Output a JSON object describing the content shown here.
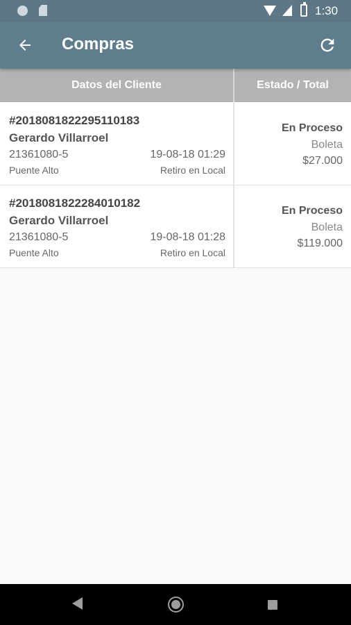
{
  "status_bar": {
    "time": "1:30"
  },
  "app_bar": {
    "title": "Compras"
  },
  "table": {
    "headers": [
      "Datos del Cliente",
      "Estado / Total"
    ],
    "rows": [
      {
        "order_id": "#201808182229511018 3",
        "client_name": "Gerardo Villarroel",
        "rut": "21361080-5",
        "date": "19-08-18 01:29",
        "city": "Puente Alto",
        "delivery": "Retiro en Local",
        "status": "En Proceso",
        "doc_type": "Boleta",
        "total": "$27.000"
      },
      {
        "order_id": "#20180818222840101 82",
        "client_name": "Gerardo Villarroel",
        "rut": "21361080-5",
        "date": "19-08-18 01:28",
        "city": "Puente Alto",
        "delivery": "Retiro en Local",
        "status": "En Proceso",
        "doc_type": "Boleta",
        "total": "$119.000"
      }
    ]
  },
  "icons": {
    "back": "arrow-left-icon",
    "refresh": "refresh-icon",
    "nav_back": "triangle-back-icon",
    "nav_home": "circle-home-icon",
    "nav_recents": "square-recents-icon"
  },
  "colors": {
    "status_bar": "#5d7787",
    "app_bar": "#607d8e",
    "table_header": "#b3b3b3",
    "row_background": "#ffffff",
    "nav_bar": "#000000"
  }
}
